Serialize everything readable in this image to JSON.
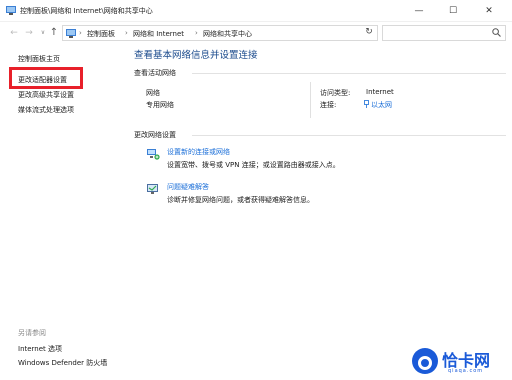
{
  "window": {
    "title": "控制面板\\网络和 Internet\\网络和共享中心",
    "minimize_glyph": "—",
    "maximize_glyph": "☐",
    "close_glyph": "✕"
  },
  "address": {
    "back_glyph": "←",
    "forward_glyph": "→",
    "recent_glyph": "∨",
    "up_glyph": "↑",
    "crumbs": [
      "控制面板",
      "网络和 Internet",
      "网络和共享中心"
    ],
    "separator": "›",
    "dropdown_glyph": "∨",
    "refresh_glyph": "↻",
    "search_placeholder": ""
  },
  "sidebar": {
    "items": [
      {
        "label": "控制面板主页"
      },
      {
        "label": "更改适配器设置"
      },
      {
        "label": "更改高级共享设置"
      },
      {
        "label": "媒体流式处理选项"
      }
    ],
    "see_also_title": "另请参阅",
    "see_also": [
      {
        "label": "Internet 选项"
      },
      {
        "label": "Windows Defender 防火墙"
      }
    ]
  },
  "main": {
    "heading": "查看基本网络信息并设置连接",
    "active_networks_label": "查看活动网络",
    "network_name": "网络",
    "network_type": "专用网络",
    "access_type_key": "访问类型:",
    "access_type_value": "Internet",
    "connections_key": "连接:",
    "connections_value": "以太网",
    "change_settings_label": "更改网络设置",
    "tasks": [
      {
        "title": "设置新的连接或网络",
        "desc": "设置宽带、拨号或 VPN 连接；或设置路由器或接入点。",
        "icon": "new-connection-icon"
      },
      {
        "title": "问题疑难解答",
        "desc": "诊断并修复网络问题，或者获得疑难解答信息。",
        "icon": "troubleshoot-icon"
      }
    ]
  },
  "watermark": {
    "brand": "恰卡网",
    "url": "qiaqa.com"
  },
  "colors": {
    "link": "#1a6ed8",
    "heading": "#1a4a8c",
    "highlight": "#e8202a",
    "watermark": "#1a5ad8"
  }
}
